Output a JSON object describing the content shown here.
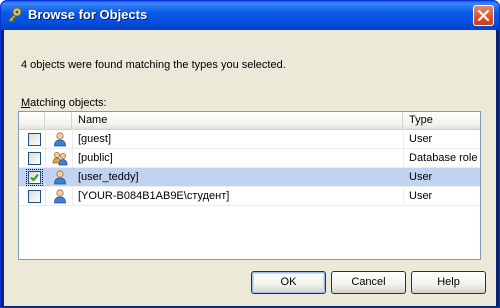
{
  "window": {
    "title": "Browse for Objects",
    "icon": "key-search-icon",
    "close_icon": "close-icon"
  },
  "info_text": "4 objects were found matching the types you selected.",
  "list_label": {
    "accel": "M",
    "rest": "atching objects:"
  },
  "columns": {
    "checkbox": "",
    "icon": "",
    "name": "Name",
    "type": "Type"
  },
  "rows": [
    {
      "checked": false,
      "selected": false,
      "icon": "user-icon",
      "name": "[guest]",
      "type": "User"
    },
    {
      "checked": false,
      "selected": false,
      "icon": "database-role-icon",
      "name": "[public]",
      "type": "Database role"
    },
    {
      "checked": true,
      "selected": true,
      "icon": "user-icon",
      "name": "[user_teddy]",
      "type": "User"
    },
    {
      "checked": false,
      "selected": false,
      "icon": "user-icon",
      "name": "[YOUR-B084B1AB9E\\студент]",
      "type": "User"
    }
  ],
  "buttons": {
    "ok": "OK",
    "cancel": "Cancel",
    "help": "Help"
  },
  "colors": {
    "title_bar": "#0a5ae6",
    "selection": "#c2d3f2",
    "dialog_bg": "#ece9d8"
  }
}
